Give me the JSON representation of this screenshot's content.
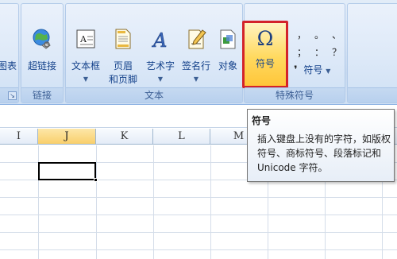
{
  "ribbon": {
    "partial_left_label": "图表",
    "groups": {
      "links": {
        "label": "链接",
        "buttons": {
          "hyperlink": "超链接"
        }
      },
      "text": {
        "label": "文本",
        "buttons": {
          "textbox": "文本框",
          "header_footer_line1": "页眉",
          "header_footer_line2": "和页脚",
          "wordart": "艺术字",
          "signature_line": "签名行",
          "object": "对象"
        }
      },
      "special_symbols": {
        "label": "特殊符号",
        "symbol_button": "符号",
        "small_symbols": [
          "，",
          "。",
          "、",
          "；",
          "：",
          "？"
        ],
        "symbol_dropdown": "符号"
      }
    },
    "symbol_glyph": "Ω"
  },
  "grid": {
    "columns": [
      "I",
      "J",
      "K",
      "L",
      "M"
    ],
    "active_column": "J"
  },
  "tooltip": {
    "title": "符号",
    "body": "插入键盘上没有的字符，如版权符号、商标符号、段落标记和 Unicode 字符。"
  },
  "colors": {
    "ribbon_bg": "#d6e4f5",
    "highlight_border": "#d3222a",
    "selected_button": "#ffd95e",
    "active_header": "#f9cf6b"
  },
  "icons": [
    "hyperlink-globe-icon",
    "textbox-icon",
    "header-footer-icon",
    "wordart-icon",
    "signature-line-icon",
    "object-icon",
    "omega-symbol-icon"
  ]
}
